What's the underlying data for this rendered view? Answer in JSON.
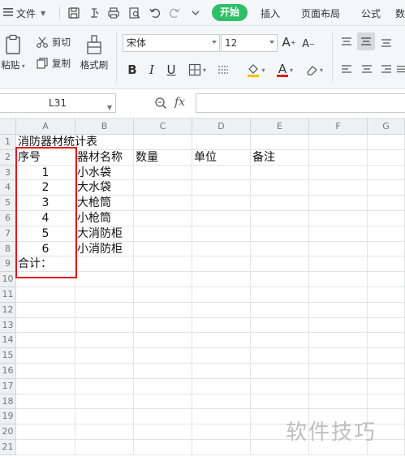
{
  "menubar": {
    "file_label": "文件",
    "active_tab": "开始",
    "tabs": [
      "插入",
      "页面布局",
      "公式",
      "数"
    ]
  },
  "ribbon": {
    "paste_label": "粘贴",
    "cut_label": "剪切",
    "copy_label": "复制",
    "format_painter_label": "格式刷",
    "font_name": "宋体",
    "font_size": "12",
    "bold": "B",
    "italic": "I",
    "underline": "U",
    "font_color_letter": "A",
    "grow_font": "A",
    "shrink_font": "A"
  },
  "formula_bar": {
    "cell_ref": "L31",
    "fx_label": "fx",
    "value": ""
  },
  "sheet": {
    "columns": [
      "A",
      "B",
      "C",
      "D",
      "E",
      "F",
      "G"
    ],
    "rows": [
      "1",
      "2",
      "3",
      "4",
      "5",
      "6",
      "7",
      "8",
      "9",
      "10",
      "11",
      "12",
      "13",
      "14",
      "15",
      "16",
      "17",
      "18",
      "19",
      "20",
      "21"
    ],
    "title": "消防器材统计表",
    "headers": [
      "序号",
      "器材名称",
      "数量",
      "单位",
      "备注"
    ],
    "data_rows": [
      {
        "no": "1",
        "name": "小水袋"
      },
      {
        "no": "2",
        "name": "大水袋"
      },
      {
        "no": "3",
        "name": "大枪筒"
      },
      {
        "no": "4",
        "name": "小枪筒"
      },
      {
        "no": "5",
        "name": "大消防柜"
      },
      {
        "no": "6",
        "name": "小消防柜"
      }
    ],
    "total_label": "合计："
  },
  "watermark": "软件技巧",
  "colors": {
    "accent_green": "#2fbf6a",
    "highlight_red": "#e21a1a",
    "font_color_red": "#e21a1a",
    "fill_yellow": "#f6c200"
  }
}
